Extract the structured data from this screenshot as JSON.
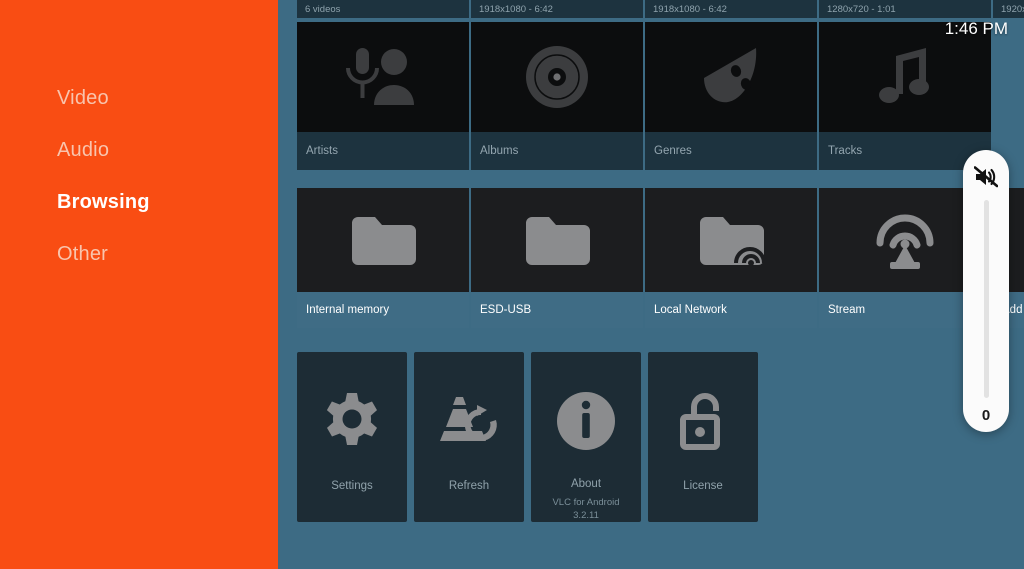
{
  "theme": {
    "sidebar_bg": "#f94d13",
    "content_bg": "#3d6b84",
    "tile_dark": "#0c0d0e",
    "caption_strip": "#1d333f",
    "caption_strip_focused": "#3f6c85",
    "action_tile": "#1d2c35"
  },
  "sidebar": {
    "items": [
      {
        "label": "Video",
        "selected": false
      },
      {
        "label": "Audio",
        "selected": false
      },
      {
        "label": "Browsing",
        "selected": true
      },
      {
        "label": "Other",
        "selected": false
      }
    ]
  },
  "status": {
    "clock": "1:46 PM"
  },
  "video_row": [
    {
      "meta": "6 videos"
    },
    {
      "meta": "1918x1080 - 6:42"
    },
    {
      "meta": "1918x1080 - 6:42"
    },
    {
      "meta": "1280x720 - 1:01"
    },
    {
      "meta": "1920x"
    }
  ],
  "music_row": [
    {
      "label": "Artists",
      "icon": "artist-microphone-icon"
    },
    {
      "label": "Albums",
      "icon": "vinyl-disc-icon"
    },
    {
      "label": "Genres",
      "icon": "theater-mask-icon"
    },
    {
      "label": "Tracks",
      "icon": "music-note-icon"
    }
  ],
  "browsing_row": [
    {
      "label": "Internal memory",
      "icon": "folder-icon"
    },
    {
      "label": "ESD-USB",
      "icon": "folder-icon"
    },
    {
      "label": "Local Network",
      "icon": "folder-network-icon"
    },
    {
      "label": "Stream",
      "icon": "broadcast-tower-icon"
    },
    {
      "label": "Add a",
      "icon": "add-icon"
    }
  ],
  "action_row": [
    {
      "label": "Settings",
      "icon": "gear-icon",
      "sub1": "",
      "sub2": ""
    },
    {
      "label": "Refresh",
      "icon": "vlc-cone-refresh-icon",
      "sub1": "",
      "sub2": ""
    },
    {
      "label": "About",
      "icon": "info-circle-icon",
      "sub1": "VLC for Android",
      "sub2": "3.2.11"
    },
    {
      "label": "License",
      "icon": "unlock-padlock-icon",
      "sub1": "",
      "sub2": ""
    }
  ],
  "volume": {
    "icon": "volume-mute-icon",
    "value": "0"
  }
}
